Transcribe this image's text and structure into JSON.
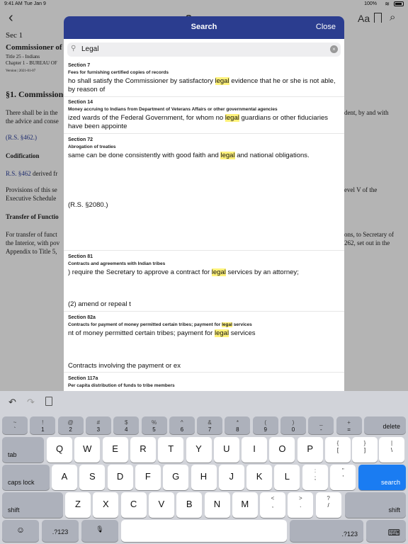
{
  "status_bar": {
    "time": "9:41 AM",
    "date": "Tue Jan 9",
    "battery_pct": "100%"
  },
  "nav": {
    "back_glyph": "‹",
    "title": "Sec",
    "aa": "Aa",
    "search_glyph": "⌕"
  },
  "document": {
    "sec_no": "Sec 1",
    "commissioner": "Commissioner of I",
    "title_line": "Title 25 - Indians",
    "chapter_line": "Chapter 1 - BUREAU OF",
    "version": "Version | 2021-01-07",
    "heading1": "§1. Commissione",
    "para1_a": "There shall be in the",
    "para1_b": "the advice and conse",
    "para1_right": "dent, by and with",
    "rs": "(R.S. §462.)",
    "codification": "Codification",
    "rs_link": "R.S. §462",
    "rs_derived_rest": " derived fr",
    "prov_a": "Provisions of this se",
    "prov_b": "Executive Schedule",
    "prov_right": "evel V of the",
    "transfer": "Transfer of Functio",
    "tr_a": "For transfer of funct",
    "tr_b": "the Interior, with pov",
    "tr_c": "Appendix to Title 5,",
    "tr_right_a": "ons, to Secretary of",
    "tr_right_b": "262, set out in the"
  },
  "search_modal": {
    "title": "Search",
    "close_label": "Close",
    "query": "Legal",
    "results": [
      {
        "section": "Section 7",
        "heading": "Fees for furnishing certified copies of records",
        "snippet_before": "ho shall satisfy the Commissioner by satisfactory ",
        "snippet_hit": "legal",
        "snippet_after": " evidence that he or she is not able, by reason of",
        "extra": ""
      },
      {
        "section": "Section 14",
        "heading": "Money accruing to Indians from Department of Veterans Affairs or other governmental agencies",
        "snippet_before": "ized wards of the Federal Government, for whom no ",
        "snippet_hit": "legal",
        "snippet_after": " guardians or other fiduciaries have been appointe",
        "extra": ""
      },
      {
        "section": "Section 72",
        "heading": "Abrogation of treaties",
        "snippet_before": "same can be done consistently with good faith and ",
        "snippet_hit": "legal",
        "snippet_after": " and national obligations.",
        "extra": "(R.S. §2080.)"
      },
      {
        "section": "Section 81",
        "heading": "Contracts and agreements with Indian tribes",
        "snippet_before": ") require the Secretary to approve a contract for ",
        "snippet_hit": "legal",
        "snippet_after": " services by an attorney;",
        "extra": "(2) amend or repeal t"
      },
      {
        "section": "Section 82a",
        "heading_before": "Contracts for payment of money permitted certain tribes; payment for ",
        "heading_hit": "legal",
        "heading_after": " services",
        "snippet_before": "nt of money permitted certain tribes; payment for ",
        "snippet_hit": "legal",
        "snippet_after": " services",
        "extra": "Contracts involving the payment or ex"
      },
      {
        "section": "Section 117a",
        "heading": "Per capita distribution of funds to tribe members"
      }
    ]
  },
  "keyboard": {
    "toolbar": {
      "undo": "↶",
      "redo": "↷"
    },
    "row1": [
      {
        "top": "~",
        "bot": "`"
      },
      {
        "top": "!",
        "bot": "1"
      },
      {
        "top": "@",
        "bot": "2"
      },
      {
        "top": "#",
        "bot": "3"
      },
      {
        "top": "$",
        "bot": "4"
      },
      {
        "top": "%",
        "bot": "5"
      },
      {
        "top": "^",
        "bot": "6"
      },
      {
        "top": "&",
        "bot": "7"
      },
      {
        "top": "*",
        "bot": "8"
      },
      {
        "top": "(",
        "bot": "9"
      },
      {
        "top": ")",
        "bot": "0"
      },
      {
        "top": "_",
        "bot": "-"
      },
      {
        "top": "+",
        "bot": "="
      }
    ],
    "delete_label": "delete",
    "tab_label": "tab",
    "row2": [
      "Q",
      "W",
      "E",
      "R",
      "T",
      "Y",
      "U",
      "I",
      "O",
      "P"
    ],
    "row2_sym": [
      {
        "top": "{",
        "bot": "["
      },
      {
        "top": "}",
        "bot": "]"
      },
      {
        "top": "|",
        "bot": "\\"
      }
    ],
    "caps_label": "caps lock",
    "row3": [
      "A",
      "S",
      "D",
      "F",
      "G",
      "H",
      "J",
      "K",
      "L"
    ],
    "row3_sym": [
      {
        "top": ":",
        "bot": ";"
      },
      {
        "top": "\"",
        "bot": "'"
      }
    ],
    "search_label": "search",
    "shift_label": "shift",
    "row4": [
      "Z",
      "X",
      "C",
      "V",
      "B",
      "N",
      "M"
    ],
    "row4_sym": [
      {
        "top": "<",
        "bot": ","
      },
      {
        "top": ">",
        "bot": "."
      },
      {
        "top": "?",
        "bot": "/"
      }
    ],
    "numbers_label": ".?123",
    "emoji_glyph": "☺",
    "mic_glyph": "🎙",
    "hide_glyph": "⌨"
  }
}
